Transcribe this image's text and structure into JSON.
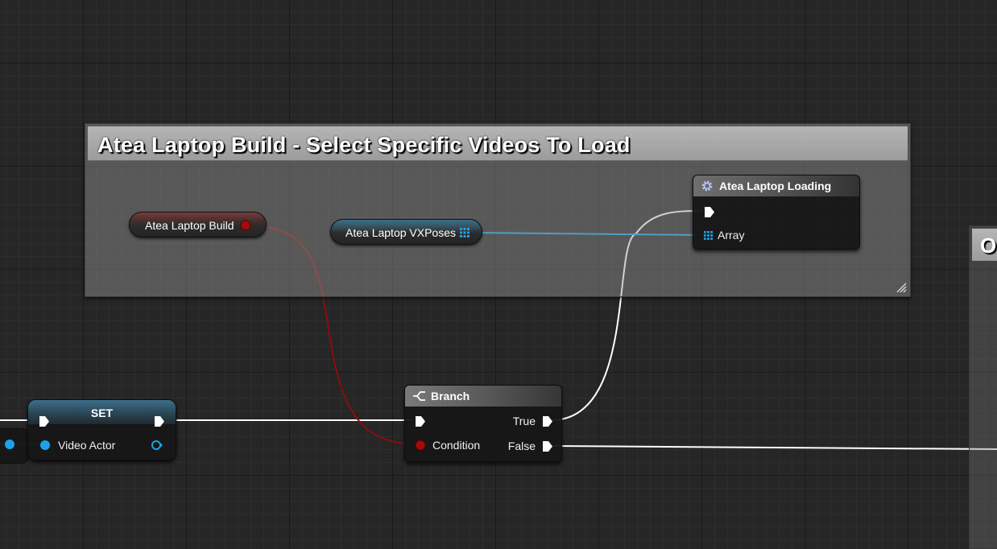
{
  "comment": {
    "title": "Atea Laptop Build - Select Specific Videos To Load"
  },
  "variables": {
    "bool_getter": {
      "label": "Atea Laptop Build"
    },
    "array_getter": {
      "label": "Atea Laptop VXPoses"
    }
  },
  "nodes": {
    "loading": {
      "title": "Atea Laptop Loading",
      "input_label": "Array"
    },
    "branch": {
      "title": "Branch",
      "condition_label": "Condition",
      "true_label": "True",
      "false_label": "False"
    },
    "set": {
      "title": "SET",
      "input_label": "Video Actor"
    }
  },
  "partial_comment": {
    "title_fragment": "O"
  },
  "colors": {
    "exec_wire": "#ffffff",
    "bool_wire": "#8b0000",
    "object_wire": "#1aa3e8",
    "bool_pin": "#9a0a0a"
  },
  "icons": {
    "function": "gear-icon",
    "branch": "branch-icon",
    "array": "array-grid-icon",
    "exec": "exec-pin-icon"
  }
}
